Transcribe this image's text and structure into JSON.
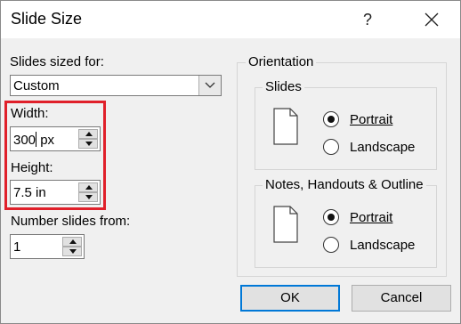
{
  "dialog": {
    "title": "Slide Size",
    "help_label": "?",
    "sized_for": {
      "label": "Slides sized for:",
      "value": "Custom"
    },
    "width": {
      "label": "Width:",
      "value": "300",
      "unit": " px"
    },
    "height": {
      "label": "Height:",
      "value": "7.5 in"
    },
    "number_from": {
      "label": "Number slides from:",
      "value": "1"
    },
    "orientation": {
      "title": "Orientation",
      "slides": {
        "title": "Slides",
        "portrait": "Portrait",
        "landscape": "Landscape",
        "selected": "portrait"
      },
      "notes": {
        "title": "Notes, Handouts & Outline",
        "portrait": "Portrait",
        "landscape": "Landscape",
        "selected": "portrait"
      }
    },
    "ok_label": "OK",
    "cancel_label": "Cancel"
  },
  "colors": {
    "highlight": "#e0202a",
    "default_button_border": "#0078d7",
    "dialog_bg": "#f0f0f0"
  },
  "icons": [
    "close-icon",
    "dropdown-arrow-icon",
    "spin-up-icon",
    "spin-down-icon",
    "portrait-page-icon"
  ]
}
